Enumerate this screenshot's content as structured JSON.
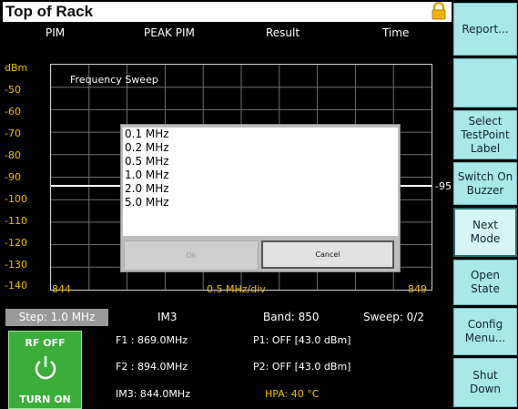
{
  "title": "Top of Rack",
  "header": {
    "pim": "PIM",
    "peak_pim": "PEAK PIM",
    "result": "Result",
    "time": "Time"
  },
  "plot": {
    "y_unit": "dBm",
    "y_ticks": [
      "-50",
      "-60",
      "-70",
      "-80",
      "-90",
      "-100",
      "-110",
      "-120",
      "-130",
      "-140"
    ],
    "label": "Frequency Sweep",
    "marker_value": "-95",
    "x_start": "844",
    "x_div": "0.5 MHz/div",
    "x_end": "849"
  },
  "popup": {
    "options": [
      "0.1 MHz",
      "0.2 MHz",
      "0.5 MHz",
      "1.0 MHz",
      "2.0 MHz",
      "5.0 MHz"
    ],
    "ok_label": "Ok",
    "cancel_label": "Cancel"
  },
  "status": {
    "step": "Step: 1.0 MHz",
    "im": "IM3",
    "band": "Band: 850",
    "sweep": "Sweep: 0/2"
  },
  "rf": {
    "state": "RF OFF",
    "action": "TURN ON"
  },
  "info": {
    "f1": "F1 : 869.0MHz",
    "f2": "F2 : 894.0MHz",
    "im3": "IM3: 844.0MHz",
    "p1": "P1: OFF [43.0 dBm]",
    "p2": "P2: OFF [43.0 dBm]",
    "hpa": "HPA: 40 °C"
  },
  "sidebar": {
    "report": "Report...",
    "select_label_line1": "Select",
    "select_label_line2": "TestPoint",
    "select_label_line3": "Label",
    "buzzer_line1": "Switch On",
    "buzzer_line2": "Buzzer",
    "next_mode_line1": "Next",
    "next_mode_line2": "Mode",
    "open_state_line1": "Open",
    "open_state_line2": "State",
    "config_line1": "Config",
    "config_line2": "Menu...",
    "shutdown_line1": "Shut",
    "shutdown_line2": "Down"
  },
  "colors": {
    "axis_text": "#e8c000",
    "rf_button": "#3aad3a",
    "softkey": "#a8e8e8"
  }
}
